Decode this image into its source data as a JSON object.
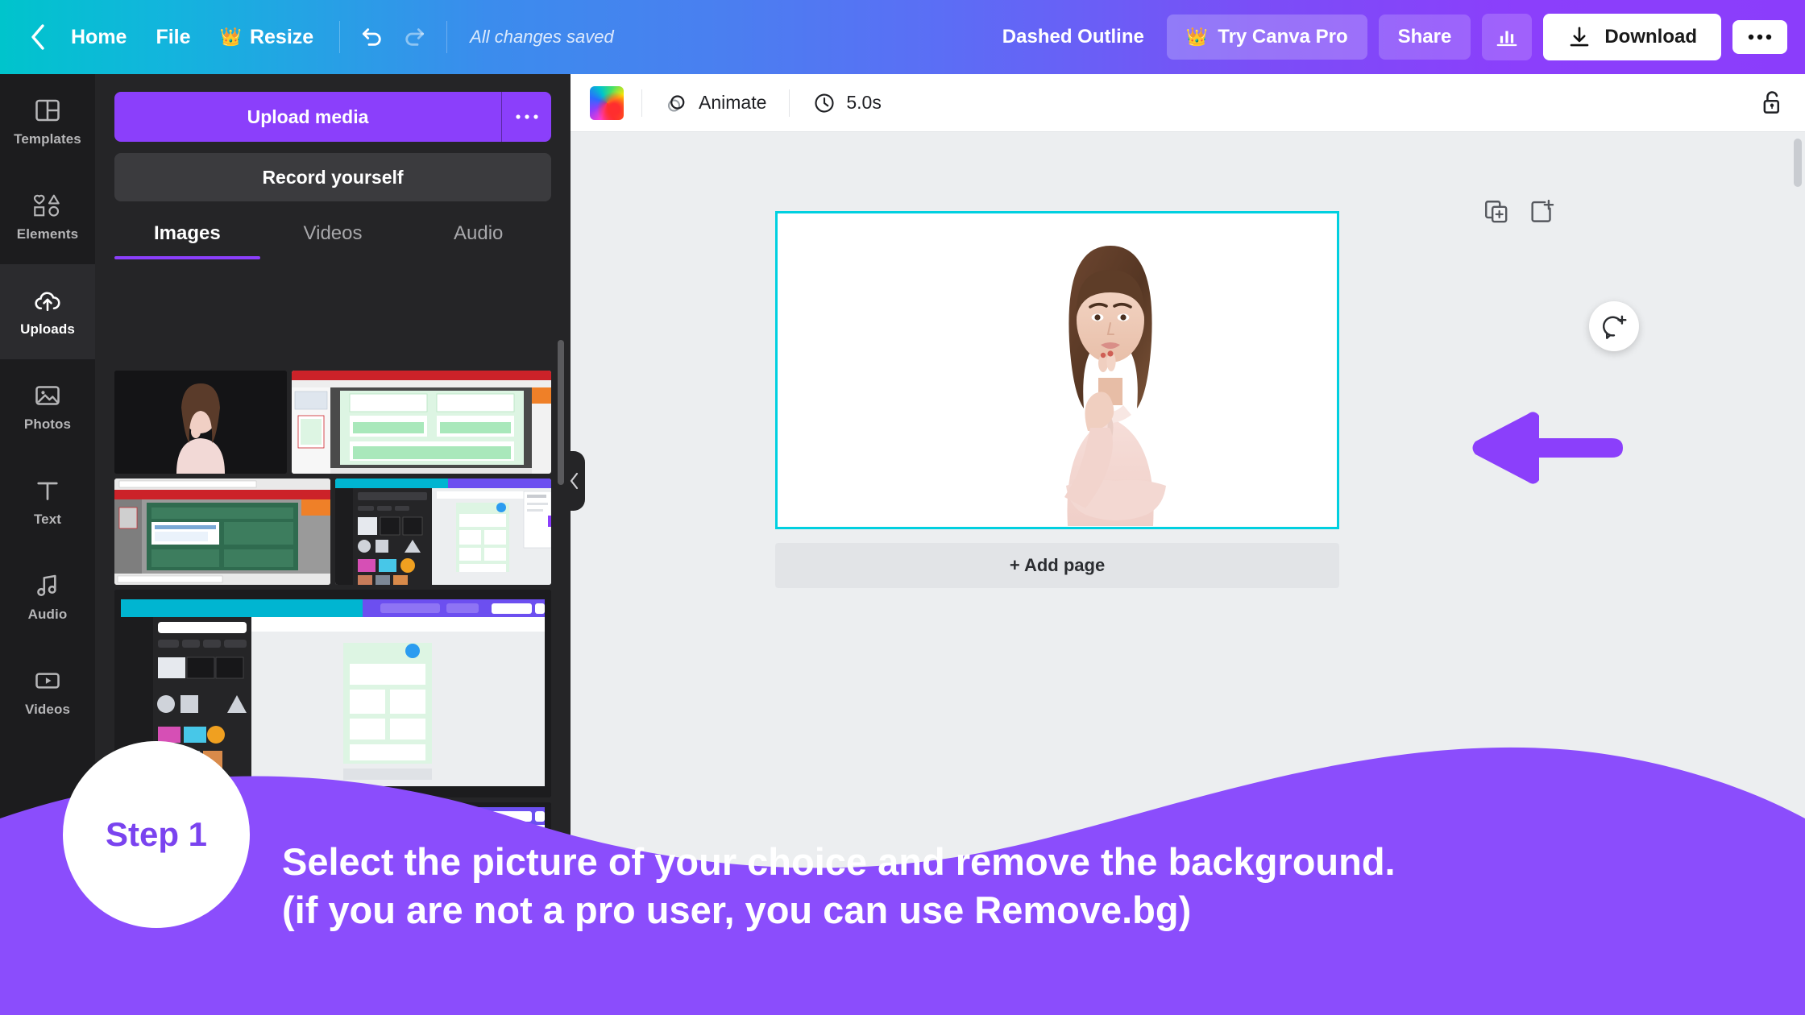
{
  "header": {
    "back_icon": "chevron-left-icon",
    "home_label": "Home",
    "file_label": "File",
    "resize_label": "Resize",
    "resize_icon": "crown-icon",
    "undo_icon": "undo-icon",
    "redo_icon": "redo-icon",
    "save_status": "All changes saved",
    "doc_title": "Dashed Outline",
    "try_pro_label": "Try Canva Pro",
    "try_pro_icon": "crown-icon",
    "share_label": "Share",
    "stats_icon": "bar-chart-icon",
    "download_label": "Download",
    "download_icon": "download-icon",
    "more_icon": "ellipsis-icon",
    "gradient_start": "#00c4cc",
    "gradient_end": "#8b3dfb"
  },
  "sidebar": {
    "items": [
      {
        "label": "Templates",
        "icon": "templates-icon",
        "active": false
      },
      {
        "label": "Elements",
        "icon": "elements-icon",
        "active": false
      },
      {
        "label": "Uploads",
        "icon": "cloud-upload-icon",
        "active": true
      },
      {
        "label": "Photos",
        "icon": "photo-icon",
        "active": false
      },
      {
        "label": "Text",
        "icon": "text-icon",
        "active": false
      },
      {
        "label": "Audio",
        "icon": "audio-icon",
        "active": false
      },
      {
        "label": "Videos",
        "icon": "video-icon",
        "active": false
      }
    ]
  },
  "uploads_panel": {
    "upload_button": "Upload media",
    "upload_more_icon": "ellipsis-icon",
    "record_button": "Record yourself",
    "tabs": [
      {
        "label": "Images",
        "active": true
      },
      {
        "label": "Videos",
        "active": false
      },
      {
        "label": "Audio",
        "active": false
      }
    ],
    "accent_color": "#8b3ffb",
    "collapse_icon": "chevron-left-icon"
  },
  "canvas_toolbar": {
    "color_swatch": "rainbow-gradient-swatch",
    "animate_label": "Animate",
    "animate_icon": "animate-icon",
    "duration_label": "5.0s",
    "duration_icon": "clock-icon",
    "lock_icon": "unlock-icon"
  },
  "canvas": {
    "duplicate_page_icon": "duplicate-page-icon",
    "add_page_icon": "add-page-icon",
    "comment_icon": "add-comment-icon",
    "selection_color": "#00d0e0",
    "arrow_color": "#8b3ffb",
    "arrow_name": "left-arrow-shape",
    "add_page_label": "+ Add page",
    "photo_alt": "woman-portrait"
  },
  "banner": {
    "badge_label": "Step 1",
    "line1": "Select the picture of your choice and remove the background.",
    "line2": "(if you are not a pro user, you can use Remove.bg)",
    "background_color": "#8b4dfc",
    "badge_text_color": "#7a43ef"
  }
}
